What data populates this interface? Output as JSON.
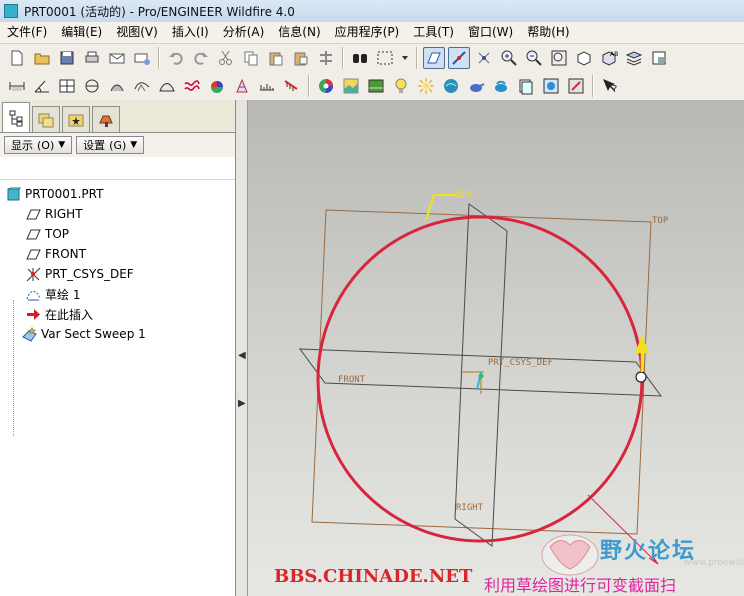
{
  "window": {
    "title": "PRT0001 (活动的) - Pro/ENGINEER Wildfire 4.0"
  },
  "menu": [
    "文件(F)",
    "编辑(E)",
    "视图(V)",
    "插入(I)",
    "分析(A)",
    "信息(N)",
    "应用程序(P)",
    "工具(T)",
    "窗口(W)",
    "帮助(H)"
  ],
  "panel": {
    "show_label": "显示",
    "show_accel": "(O)",
    "settings_label": "设置",
    "settings_accel": "(G)"
  },
  "tree": {
    "root": "PRT0001.PRT",
    "items": [
      "RIGHT",
      "TOP",
      "FRONT",
      "PRT_CSYS_DEF",
      "草绘 1",
      "在此插入",
      "Var Sect Sweep 1"
    ]
  },
  "viewport": {
    "labels": {
      "top": "TOP",
      "front": "FRONT",
      "right": "RIGHT",
      "csys": "PRT_CSYS_DEF",
      "start_marker": "起点"
    },
    "colors": {
      "plane_top": "#9b6b3f",
      "plane_right": "#4a4a4a",
      "circle": "#d8253c",
      "arrow": "#f2e21a"
    }
  },
  "watermark": {
    "url": "BBS.CHINADE.NET",
    "forum_name": "野火论坛",
    "forum_sub": "www.proewildfire.cn",
    "caption": "利用草绘图进行可变截面扫"
  }
}
